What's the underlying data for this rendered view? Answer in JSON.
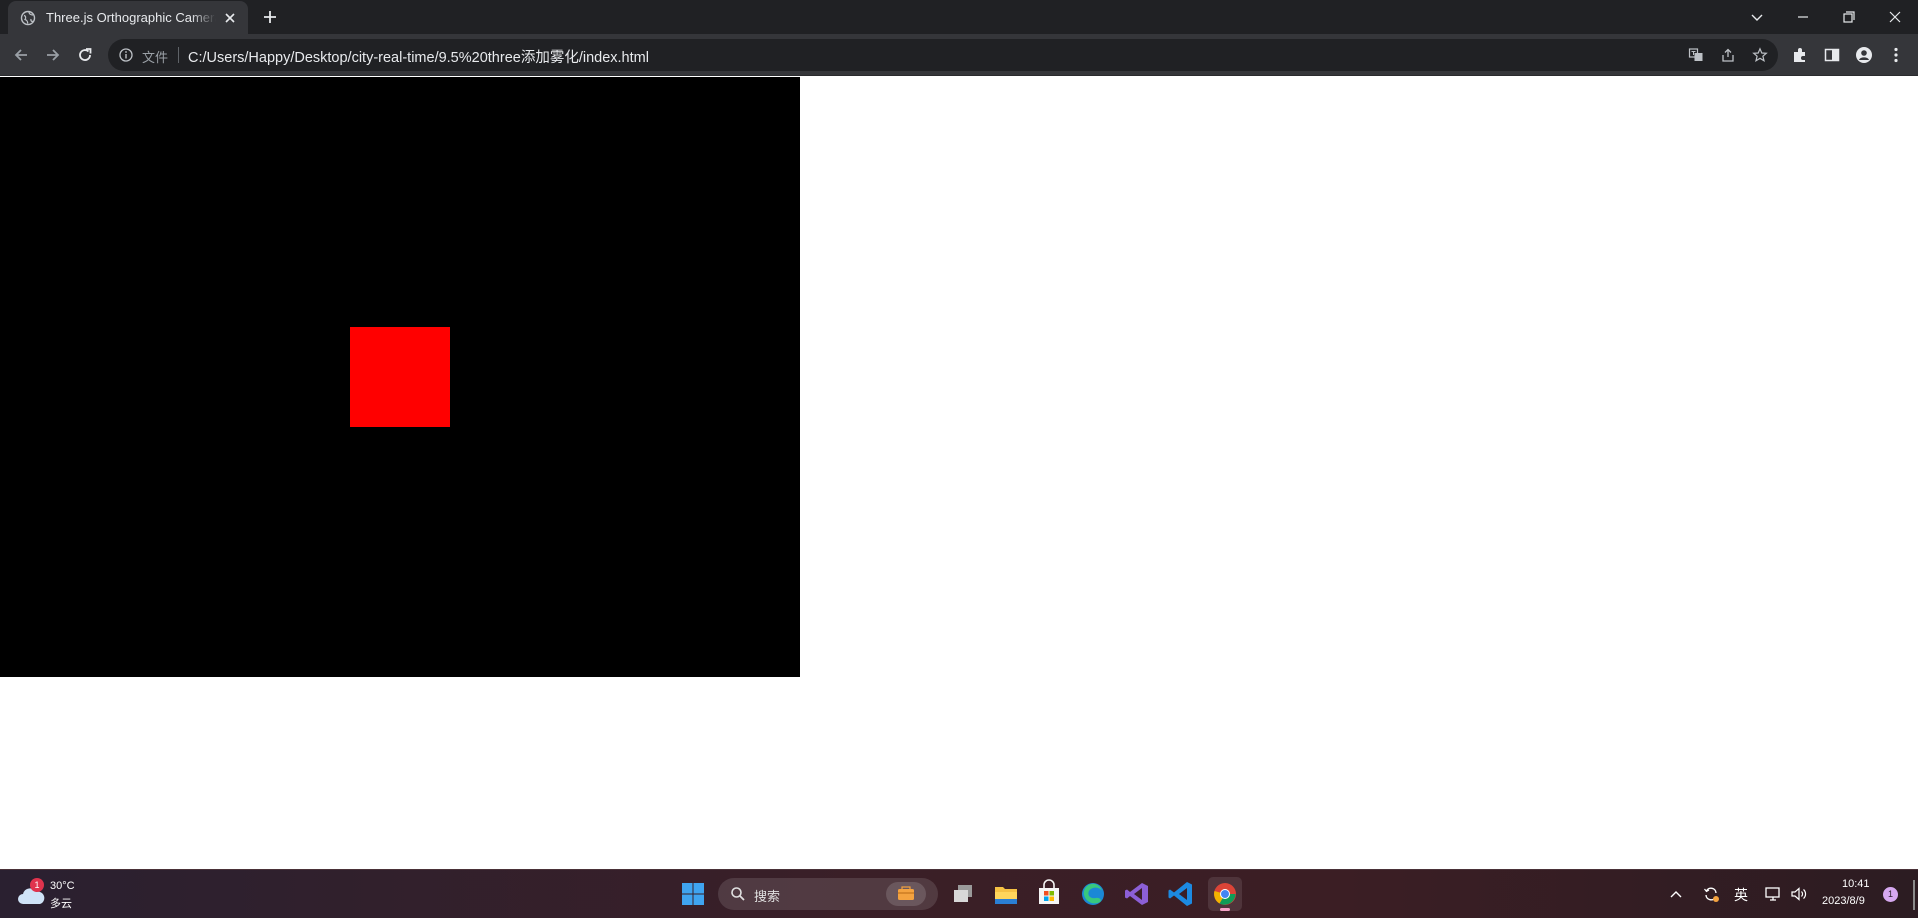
{
  "browser": {
    "tab_title": "Three.js Orthographic Camera",
    "url_scheme": "文件",
    "url": "C:/Users/Happy/Desktop/city-real-time/9.5%20three添加雾化/index.html"
  },
  "page": {
    "canvas_background": "#000000",
    "cube_color": "#ff0000"
  },
  "taskbar": {
    "weather_temp": "30°C",
    "weather_desc": "多云",
    "weather_badge": "1",
    "search_placeholder": "搜索",
    "ime": "英",
    "time": "10:41",
    "date": "2023/8/9",
    "notification_count": "1",
    "apps": [
      "start",
      "search",
      "task-view",
      "file-explorer",
      "microsoft-store",
      "edge",
      "visual-studio",
      "vscode",
      "chrome"
    ]
  }
}
